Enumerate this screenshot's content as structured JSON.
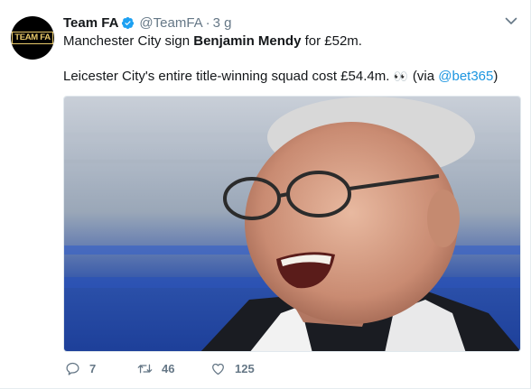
{
  "tweet": {
    "display_name": "Team FA",
    "handle": "@TeamFA",
    "separator": "·",
    "time": "3 g",
    "avatar_text": "TEAM FA",
    "line1": {
      "prefix": "Manchester City sign ",
      "bold": "Benjamin Mendy",
      "suffix": " for £52m."
    },
    "line2": {
      "text": "Leicester City's entire title-winning squad cost £54.4m.",
      "emoji": "👀",
      "via_open": "(via",
      "mention": "@bet365",
      "via_close": ")"
    },
    "media_description_icon": "photo"
  },
  "actions": {
    "replies": "7",
    "retweets": "46",
    "likes": "125"
  },
  "colors": {
    "link": "#1b95e0",
    "verified": "#1da1f2",
    "muted": "#657786"
  },
  "icons": {
    "verified": "verified-badge-icon",
    "menu": "chevron-down-icon",
    "reply": "reply-icon",
    "retweet": "retweet-icon",
    "like": "heart-icon"
  }
}
